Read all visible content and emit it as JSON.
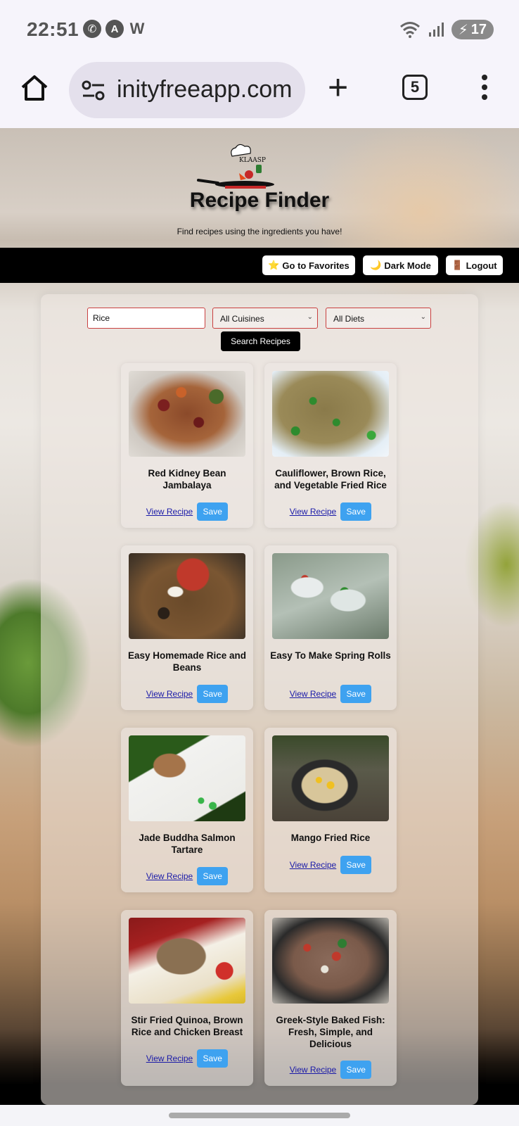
{
  "status_bar": {
    "time": "22:51",
    "battery": "17",
    "icons": [
      "whatsapp-icon",
      "app-a-icon",
      "app-w-icon",
      "wifi-icon",
      "signal-icon",
      "battery-icon"
    ]
  },
  "browser": {
    "url": "inityfreeapp.com",
    "tab_count": "5"
  },
  "header": {
    "title": "Recipe Finder",
    "subtitle": "Find recipes using the ingredients you have!",
    "logo_text": "KLAASP"
  },
  "nav": {
    "favorites_icon": "⭐",
    "favorites_label": "Go to Favorites",
    "dark_mode_icon": "🌙",
    "dark_mode_label": "Dark Mode",
    "logout_icon": "🚪",
    "logout_label": "Logout"
  },
  "search": {
    "value": "Rice",
    "cuisine": "All Cuisines",
    "diet": "All Diets",
    "button": "Search Recipes"
  },
  "actions": {
    "view": "View Recipe",
    "save": "Save"
  },
  "recipes": [
    {
      "title": "Red Kidney Bean Jambalaya"
    },
    {
      "title": "Cauliflower, Brown Rice, and Vegetable Fried Rice"
    },
    {
      "title": "Easy Homemade Rice and Beans"
    },
    {
      "title": "Easy To Make Spring Rolls"
    },
    {
      "title": "Jade Buddha Salmon Tartare"
    },
    {
      "title": "Mango Fried Rice"
    },
    {
      "title": "Stir Fried Quinoa, Brown Rice and Chicken Breast"
    },
    {
      "title": "Greek-Style Baked Fish: Fresh, Simple, and Delicious"
    }
  ]
}
